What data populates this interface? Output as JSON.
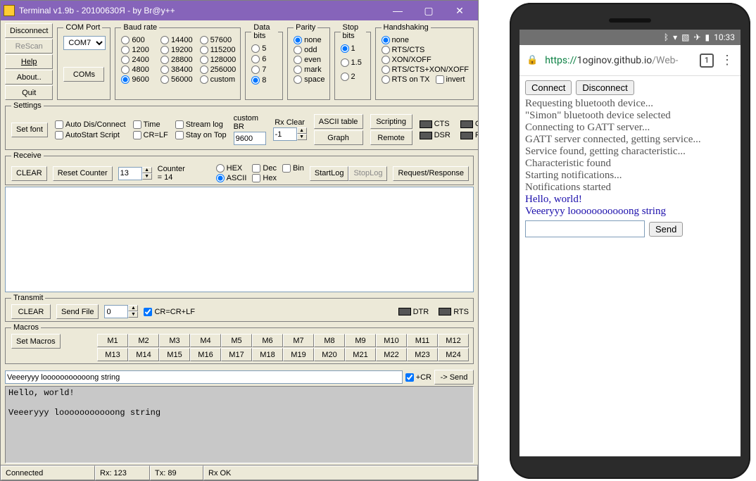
{
  "win": {
    "title": "Terminal v1.9b - 20100630Я - by Br@y++",
    "left": {
      "disconnect": "Disconnect",
      "rescan": "ReScan",
      "help": "Help",
      "about": "About..",
      "quit": "Quit"
    },
    "comport": {
      "legend": "COM Port",
      "value": "COM7",
      "coms": "COMs"
    },
    "baud": {
      "legend": "Baud rate",
      "opts": [
        "600",
        "1200",
        "2400",
        "4800",
        "9600",
        "14400",
        "19200",
        "28800",
        "38400",
        "56000",
        "57600",
        "115200",
        "128000",
        "256000",
        "custom"
      ],
      "sel": "9600"
    },
    "databits": {
      "legend": "Data bits",
      "opts": [
        "5",
        "6",
        "7",
        "8"
      ],
      "sel": "8"
    },
    "parity": {
      "legend": "Parity",
      "opts": [
        "none",
        "odd",
        "even",
        "mark",
        "space"
      ],
      "sel": "none"
    },
    "stopbits": {
      "legend": "Stop bits",
      "opts": [
        "1",
        "1.5",
        "2"
      ],
      "sel": "1"
    },
    "handshake": {
      "legend": "Handshaking",
      "opts": [
        "none",
        "RTS/CTS",
        "XON/XOFF",
        "RTS/CTS+XON/XOFF",
        "RTS on TX"
      ],
      "sel": "none",
      "invert": "invert"
    },
    "settings": {
      "legend": "Settings",
      "setfont": "Set font",
      "autodis": "Auto Dis/Connect",
      "autostart": "AutoStart Script",
      "time": "Time",
      "crlf": "CR=LF",
      "stream": "Stream log",
      "stay": "Stay on Top",
      "custombr_lbl": "custom BR",
      "custombr_val": "9600",
      "rxclear_lbl": "Rx Clear",
      "rxclear_val": "-1",
      "ascii": "ASCII table",
      "graph": "Graph",
      "script": "Scripting",
      "remote": "Remote",
      "cts": "CTS",
      "cd": "CD",
      "dsr": "DSR",
      "ri": "RI"
    },
    "recv": {
      "legend": "Receive",
      "clear": "CLEAR",
      "reset": "Reset Counter",
      "cnt_val": "13",
      "counter": "Counter = 14",
      "hex": "HEX",
      "ascii": "ASCII",
      "dec": "Dec",
      "hexcb": "Hex",
      "bin": "Bin",
      "startlog": "StartLog",
      "stoplog": "StopLog",
      "reqres": "Request/Response"
    },
    "xmit": {
      "legend": "Transmit",
      "clear": "CLEAR",
      "sendfile": "Send File",
      "num": "0",
      "crcb": "CR=CR+LF",
      "dtr": "DTR",
      "rts": "RTS"
    },
    "macros": {
      "legend": "Macros",
      "set": "Set Macros",
      "row1": [
        "M1",
        "M2",
        "M3",
        "M4",
        "M5",
        "M6",
        "M7",
        "M8",
        "M9",
        "M10",
        "M11",
        "M12"
      ],
      "row2": [
        "M13",
        "M14",
        "M15",
        "M16",
        "M17",
        "M18",
        "M19",
        "M20",
        "M21",
        "M22",
        "M23",
        "M24"
      ]
    },
    "send": {
      "value": "Veeeryyy looooooooooong string",
      "cr": "+CR",
      "btn": "-> Send"
    },
    "echo": "Hello, world!\n\nVeeeryyy looooooooooong string",
    "status": {
      "conn": "Connected",
      "rx": "Rx: 123",
      "tx": "Tx: 89",
      "rxok": "Rx OK"
    }
  },
  "phone": {
    "time": "10:33",
    "url_scheme": "https://",
    "url_host": "1oginov.github.io",
    "url_path": "/Web-",
    "tabcount": "1",
    "connect": "Connect",
    "disconnect": "Disconnect",
    "log": [
      "Requesting bluetooth device...",
      "\"Simon\" bluetooth device selected",
      "Connecting to GATT server...",
      "GATT server connected, getting service...",
      "Service found, getting characteristic...",
      "Characteristic found",
      "Starting notifications...",
      "Notifications started"
    ],
    "blue": [
      "Hello, world!",
      "Veeeryyy looooooooooong string"
    ],
    "send": "Send"
  }
}
